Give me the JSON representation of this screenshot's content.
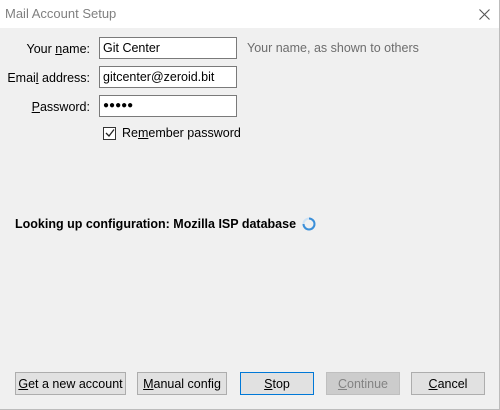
{
  "window": {
    "title": "Mail Account Setup"
  },
  "form": {
    "name": {
      "label_pre": "Your ",
      "label_accel": "n",
      "label_post": "ame:",
      "value": "Git Center",
      "hint": "Your name, as shown to others"
    },
    "email": {
      "label_pre": "Emai",
      "label_accel": "l",
      "label_post": " address:",
      "value": "gitcenter@zeroid.bit"
    },
    "password": {
      "label_pre": "",
      "label_accel": "P",
      "label_post": "assword:",
      "value": "●●●●●"
    },
    "remember": {
      "label_pre": "Re",
      "label_accel": "m",
      "label_post": "ember password",
      "checked": true
    }
  },
  "status": {
    "text": "Looking up configuration: Mozilla ISP database"
  },
  "buttons": {
    "new_account": {
      "pre": "",
      "accel": "G",
      "post": "et a new account"
    },
    "manual_config": {
      "pre": "",
      "accel": "M",
      "post": "anual config"
    },
    "stop": {
      "pre": "",
      "accel": "S",
      "post": "top"
    },
    "continue": {
      "pre": "",
      "accel": "C",
      "post": "ontinue"
    },
    "cancel": {
      "pre": "",
      "accel": "C",
      "post": "ancel"
    }
  },
  "colors": {
    "accent": "#0078d7",
    "background": "#f0f0f0"
  }
}
